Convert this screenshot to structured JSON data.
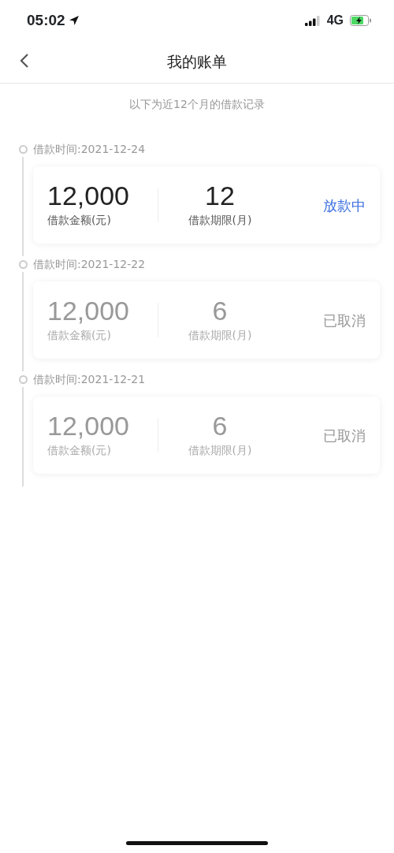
{
  "status_bar": {
    "time": "05:02",
    "network": "4G"
  },
  "nav": {
    "title": "我的账单"
  },
  "subtitle": "以下为近12个月的借款记录",
  "loans": [
    {
      "date": "借款时间:2021-12-24",
      "amount": "12,000",
      "amount_label": "借款金额(元)",
      "term": "12",
      "term_label": "借款期限(月)",
      "status": "放款中",
      "kind": "active"
    },
    {
      "date": "借款时间:2021-12-22",
      "amount": "12,000",
      "amount_label": "借款金额(元)",
      "term": "6",
      "term_label": "借款期限(月)",
      "status": "已取消",
      "kind": "cancelled"
    },
    {
      "date": "借款时间:2021-12-21",
      "amount": "12,000",
      "amount_label": "借款金额(元)",
      "term": "6",
      "term_label": "借款期限(月)",
      "status": "已取消",
      "kind": "cancelled"
    }
  ]
}
